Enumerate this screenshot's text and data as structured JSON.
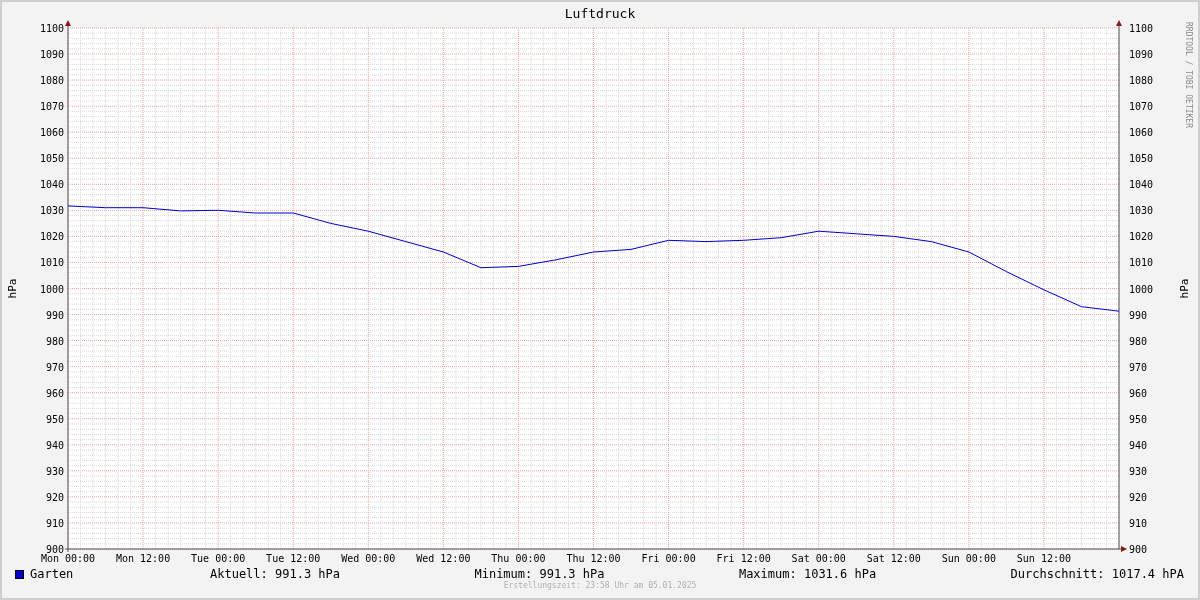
{
  "watermark": "RRDTOOL / TOBI OETIKER",
  "chart_data": {
    "type": "line",
    "title": "Luftdruck",
    "ylabel": "hPa",
    "categories": [
      "Mon 00:00",
      null,
      "Mon 12:00",
      null,
      "Tue 00:00",
      null,
      "Tue 12:00",
      null,
      "Wed 00:00",
      null,
      "Wed 12:00",
      null,
      "Thu 00:00",
      null,
      "Thu 12:00",
      null,
      "Fri 00:00",
      null,
      "Fri 12:00",
      null,
      "Sat 00:00",
      null,
      "Sat 12:00",
      null,
      "Sun 00:00",
      null,
      "Sun 12:00",
      null,
      null
    ],
    "series": [
      {
        "name": "Garten",
        "color": "#0000cc",
        "values": [
          1031.7,
          1031,
          1031,
          1029.8,
          1030,
          1029,
          1029,
          1025,
          1022,
          1018,
          1014,
          1008,
          1008.5,
          1011,
          1014,
          1015,
          1018.5,
          1018,
          1018.5,
          1019.5,
          1022,
          1021,
          1020,
          1018,
          1014,
          1006.5,
          999.5,
          993,
          991.3
        ]
      }
    ],
    "ylim": [
      900,
      1100
    ],
    "grid": true,
    "yticks": [
      900,
      910,
      920,
      930,
      940,
      950,
      960,
      970,
      980,
      990,
      1000,
      1010,
      1020,
      1030,
      1040,
      1050,
      1060,
      1070,
      1080,
      1090,
      1100
    ]
  },
  "right_axis": {
    "label": "hPa",
    "ticks": [
      "1100",
      "1090",
      "1080",
      "1070",
      "1060",
      "1050",
      "1040",
      "1030",
      "1020",
      "1010",
      "1000",
      "990",
      "980",
      "970",
      "960",
      "950",
      "940",
      "930",
      "920",
      "910",
      "900"
    ]
  },
  "stats": [
    "Aktuell: 991.3 hPa",
    "Minimum: 991.3 hPa",
    "Maximum: 1031.6 hPa",
    "Durchschnitt: 1017.4 hPA"
  ],
  "footer": "Erstellungszeit: 23:58 Uhr am 05.01.2025"
}
